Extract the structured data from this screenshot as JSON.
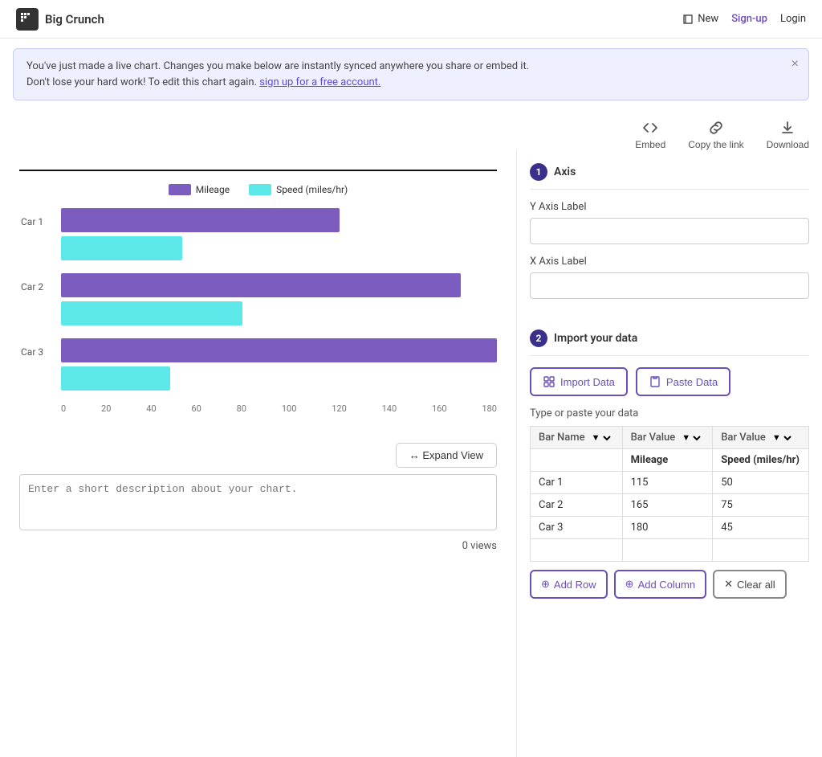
{
  "header": {
    "logo_text": "Big Crunch",
    "new_label": "New",
    "signup_label": "Sign-up",
    "login_label": "Login"
  },
  "banner": {
    "message1": "You've just made a live chart. Changes you make below are instantly synced anywhere you share or embed it.",
    "message2": "Don't lose your hard work! To edit this chart again.",
    "link_text": "sign up for a free account.",
    "close_label": "×"
  },
  "toolbar": {
    "embed_label": "Embed",
    "copy_link_label": "Copy the link",
    "download_label": "Download"
  },
  "chart": {
    "legend": [
      {
        "label": "Mileage",
        "color": "#7c5cbf"
      },
      {
        "label": "Speed (miles/hr)",
        "color": "#5ce8e8"
      }
    ],
    "bars": [
      {
        "label": "Car 1",
        "mileage": 115,
        "speed": 50,
        "mileage_pct": 63.9,
        "speed_pct": 27.8
      },
      {
        "label": "Car 2",
        "mileage": 165,
        "speed": 75,
        "mileage_pct": 91.7,
        "speed_pct": 41.7
      },
      {
        "label": "Car 3",
        "mileage": 180,
        "speed": 45,
        "mileage_pct": 100,
        "speed_pct": 25
      }
    ],
    "x_axis": [
      "0",
      "20",
      "40",
      "60",
      "80",
      "100",
      "120",
      "140",
      "160",
      "180"
    ],
    "expand_label": "↔ Expand View",
    "description_placeholder": "Enter a short description about your chart.",
    "views": "0 views"
  },
  "settings": {
    "axis_section_num": "1",
    "axis_section_label": "Axis",
    "y_axis_label": "Y Axis Label",
    "x_axis_label": "X Axis Label",
    "import_section_num": "2",
    "import_section_label": "Import your data",
    "import_data_label": "Import Data",
    "paste_data_label": "Paste Data",
    "type_paste_label": "Type or paste your data",
    "table": {
      "col1_header": "Bar Name",
      "col2_header": "Bar Value",
      "col3_header": "Bar Value",
      "col2_sub": "Mileage",
      "col3_sub": "Speed (miles/hr)",
      "rows": [
        {
          "name": "Car 1",
          "val1": "115",
          "val2": "50"
        },
        {
          "name": "Car 2",
          "val1": "165",
          "val2": "75"
        },
        {
          "name": "Car 3",
          "val1": "180",
          "val2": "45"
        }
      ]
    },
    "add_row_label": "Add Row",
    "add_column_label": "Add Column",
    "clear_all_label": "Clear all"
  }
}
